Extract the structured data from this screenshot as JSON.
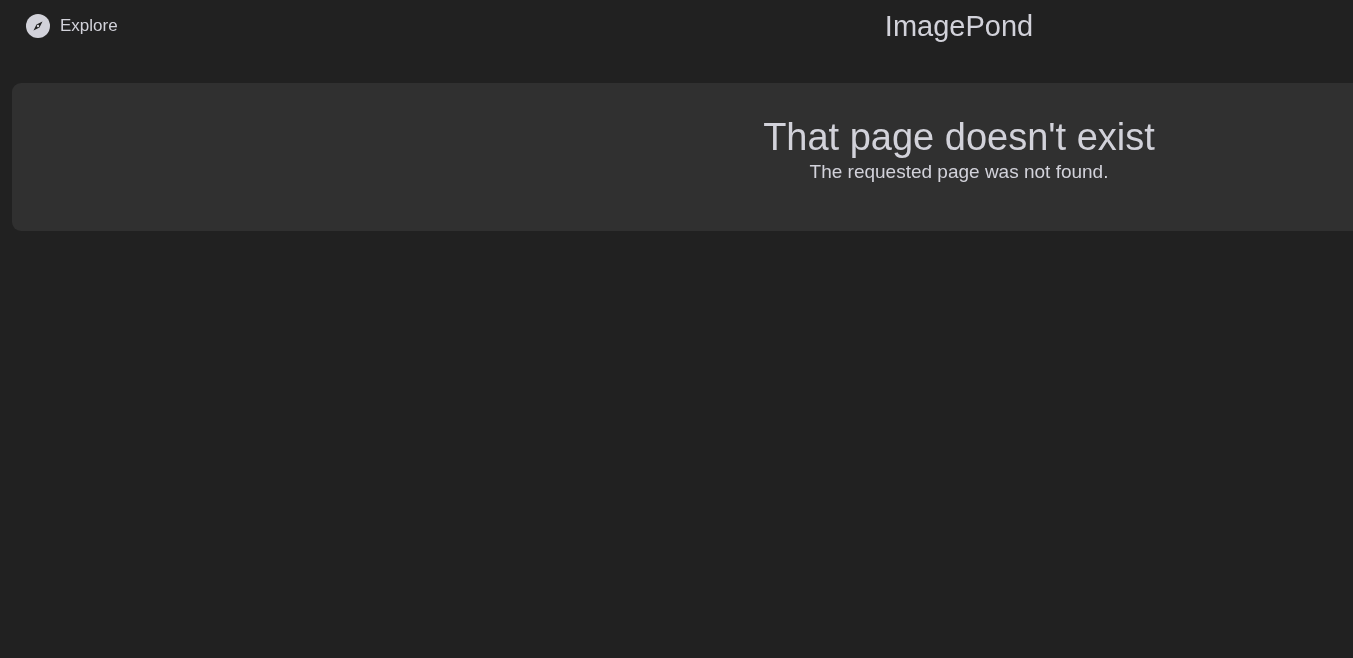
{
  "header": {
    "nav_link": "Explore",
    "title": "ImagePond"
  },
  "error": {
    "heading": "That page doesn't exist",
    "message": "The requested page was not found."
  }
}
